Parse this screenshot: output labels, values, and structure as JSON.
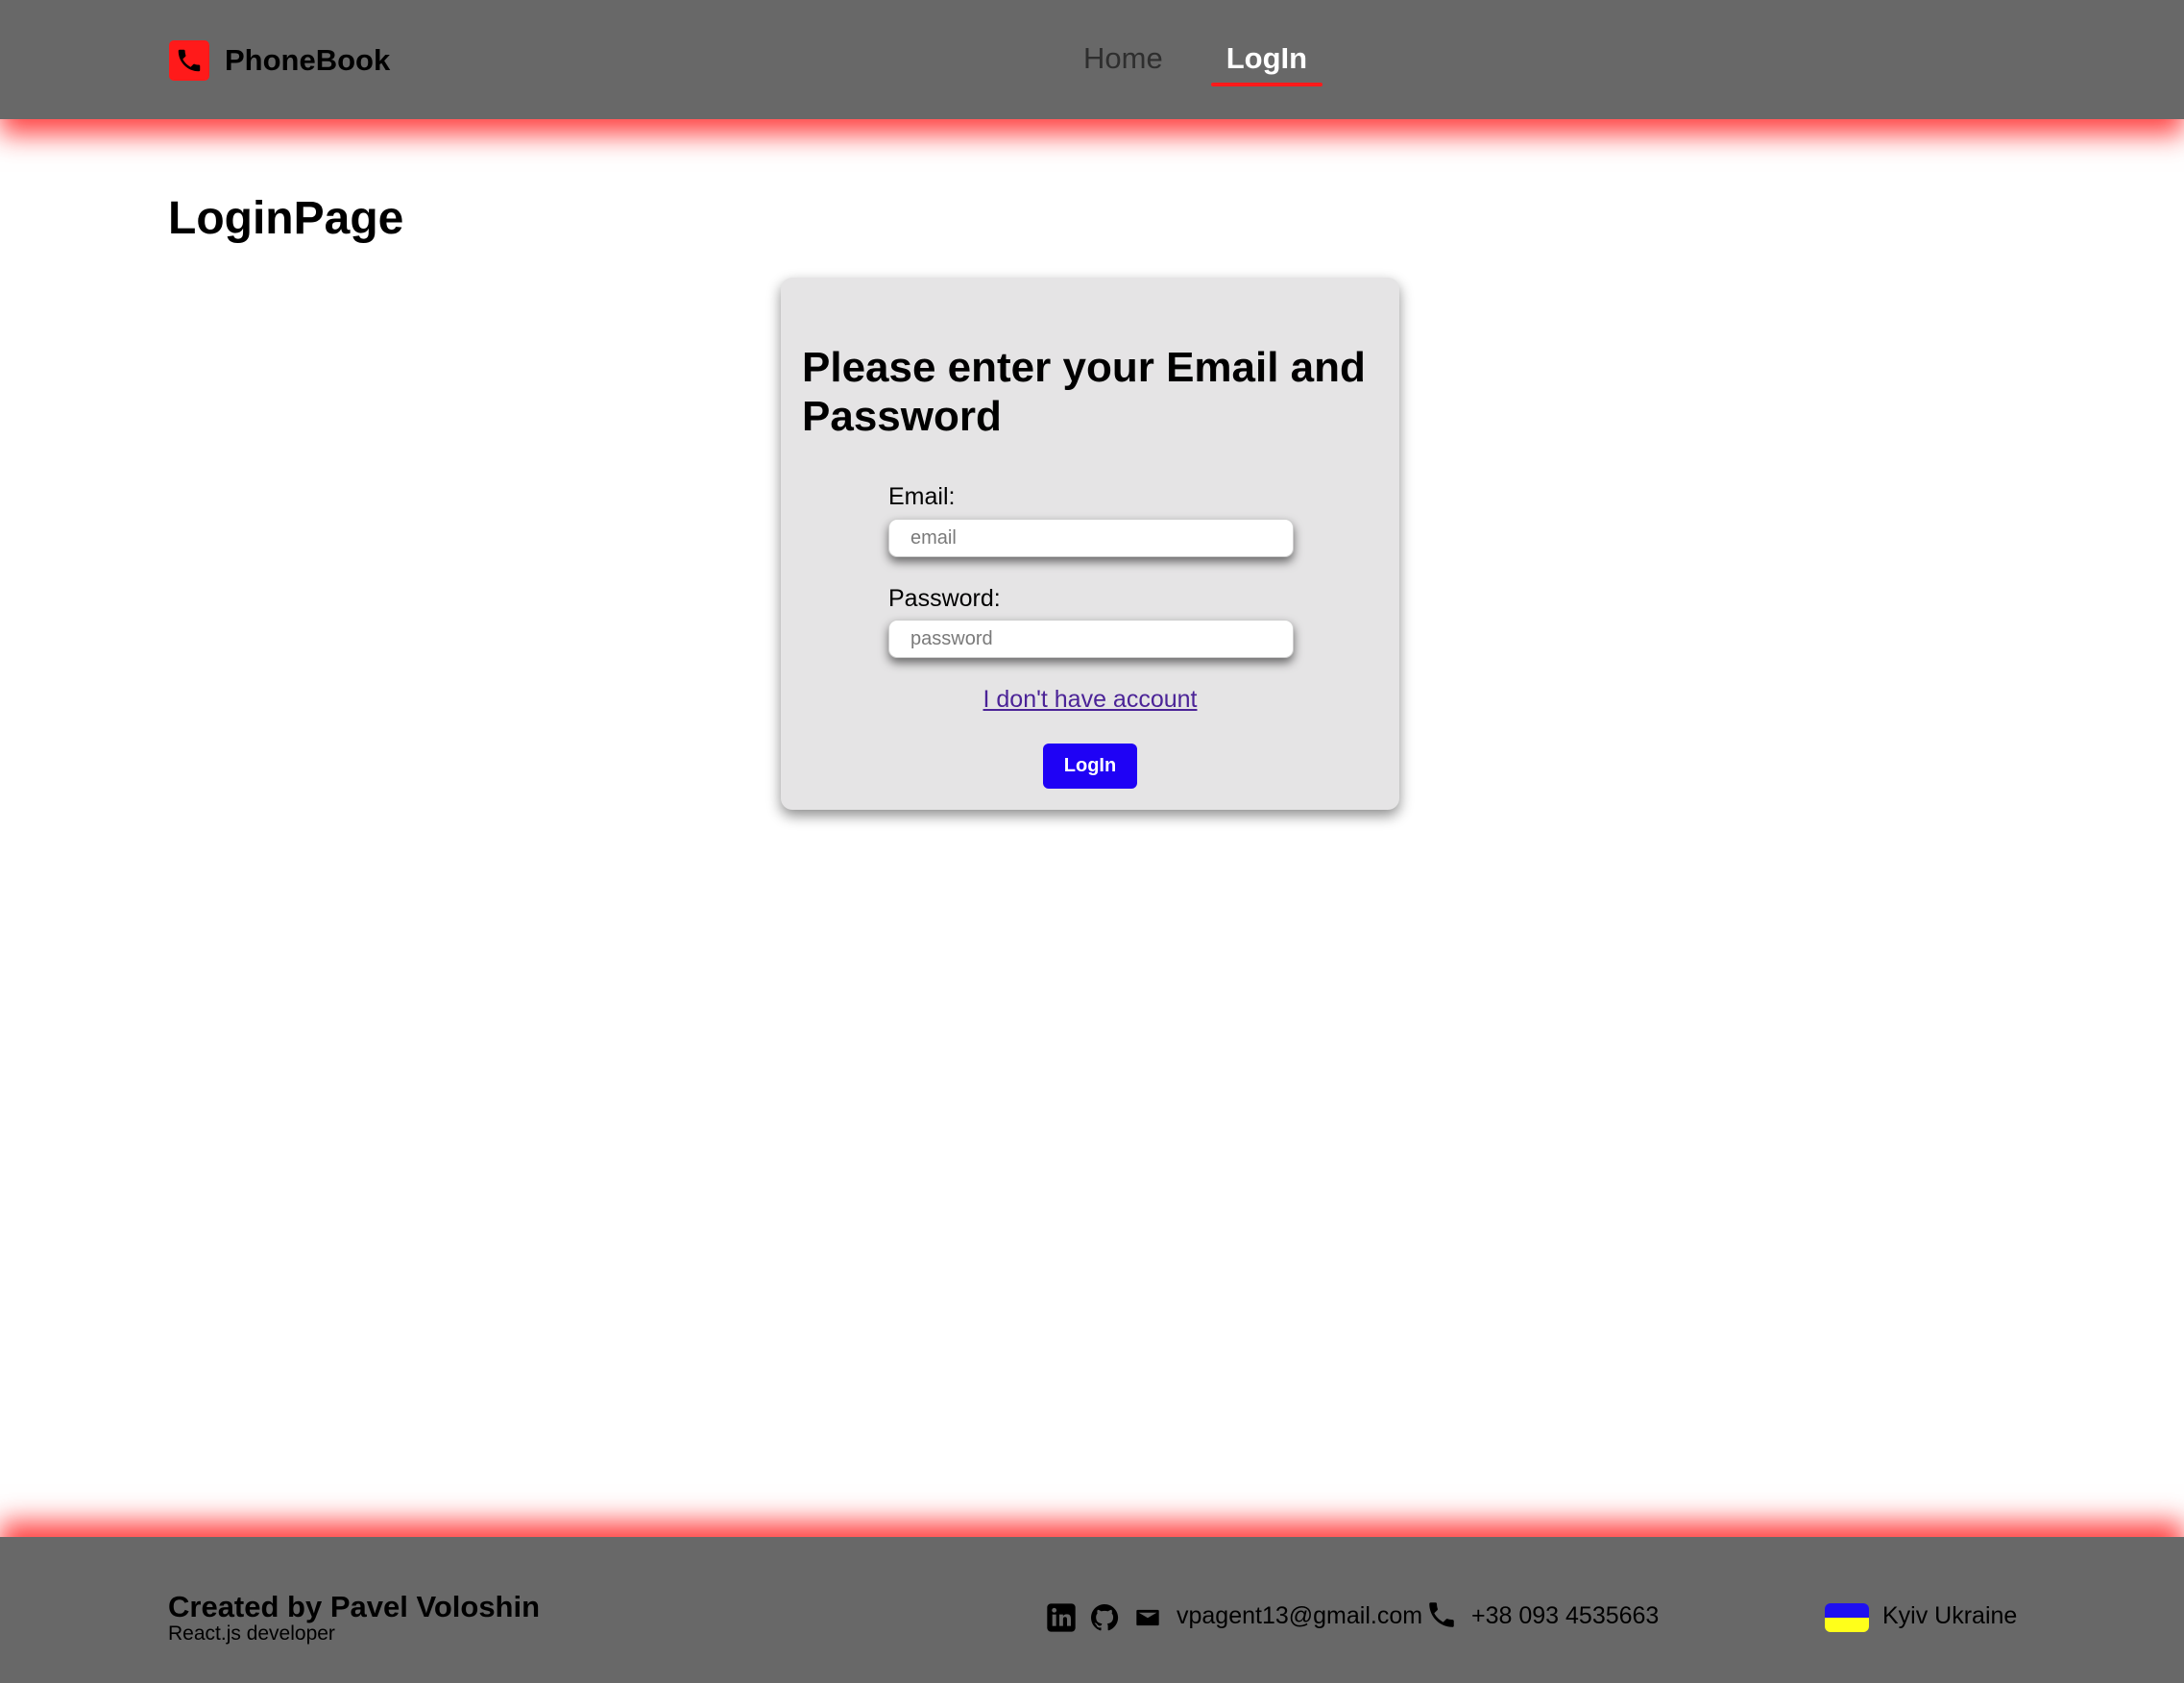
{
  "header": {
    "logo_text": "PhoneBook",
    "logo_icon": "phone-icon",
    "nav": {
      "home": "Home",
      "login": "LogIn",
      "active": "LogIn"
    }
  },
  "page": {
    "title": "LoginPage"
  },
  "login_form": {
    "heading": "Please enter your Email and Password",
    "email_label": "Email:",
    "email_placeholder": "email",
    "email_value": "",
    "password_label": "Password:",
    "password_placeholder": "password",
    "password_value": "",
    "register_link": "I don't have account",
    "submit_label": "LogIn"
  },
  "footer": {
    "name": "Created by Pavel Voloshin",
    "role": "React.js developer",
    "social_icons": [
      "linkedin-icon",
      "github-icon",
      "mail-icon"
    ],
    "email": "vpagent13@gmail.com",
    "phone": "+38 093 4535663",
    "location": "Kyiv Ukraine",
    "flag_icon": "ukraine-flag-icon"
  },
  "colors": {
    "bar_background": "#686868",
    "accent_red": "#ff1a1a",
    "card_background": "#e5e4e5",
    "button_blue": "#1f02f5",
    "link_purple": "#4b2397",
    "flag_blue": "#1f10f0",
    "flag_yellow": "#ffff1a"
  }
}
